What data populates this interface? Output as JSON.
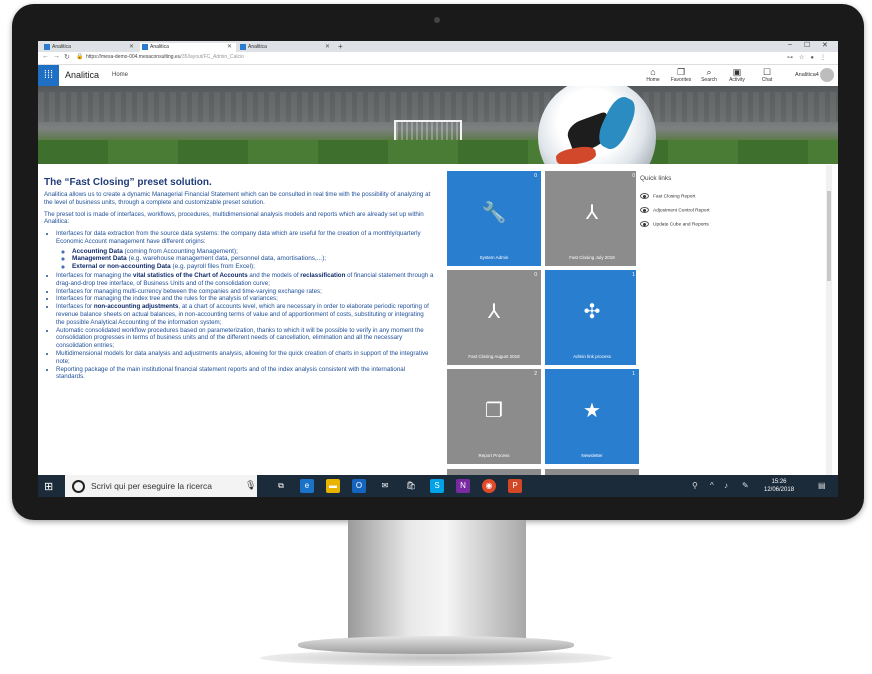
{
  "browser": {
    "tabs": [
      "Analitica",
      "Analitica",
      "Analitica"
    ],
    "new_tab": "+",
    "window_controls": [
      "–",
      "☐",
      "✕"
    ],
    "url_host": "https://mesa-demo-004.mesaconsulting.eu",
    "url_path": "/35/layout/FC_Admin_Calcio"
  },
  "app": {
    "title": "Analitica",
    "breadcrumb": "Home",
    "header_icons": [
      {
        "icon": "home-icon",
        "label": "Home"
      },
      {
        "icon": "favorites-icon",
        "label": "Favorites"
      },
      {
        "icon": "search-icon",
        "label": "Search"
      },
      {
        "icon": "activity-icon",
        "label": "Activity"
      },
      {
        "icon": "chat-icon",
        "label": "Chat"
      }
    ],
    "user": "Analitica4"
  },
  "content": {
    "title": "The “Fast Closing” preset solution.",
    "p1": "Analitica allows us to create a dynamic Managerial Financial Statement which can be consulted in real time with the possibility of analyzing at the level of business units, through a complete and customizable preset solution.",
    "p2": "The preset tool is made of interfaces, workflows, procedures, multidimensional analysis models and reports which are already set up within Analitica:",
    "b1": "Interfaces for data extraction from the source data systems: the company data which are useful for the creation of a monthly/quarterly Economic Account management have different origins:",
    "s1_bold": "Accounting Data",
    "s1_rest": " (coming from Accounting Management);",
    "s2_bold": "Management Data",
    "s2_rest": " (e.g. warehouse management data, personnel data, amortisations,...);",
    "s3_bold": "External or non-accounting Data",
    "s3_rest": " (e.g. payroll files from Excel);",
    "b2_a": "Interfaces for managing the ",
    "b2_bold1": "vital statistics of the Chart of Accounts",
    "b2_b": " and the models of ",
    "b2_bold2": "reclassification",
    "b2_c": " of financial statement through a drag-and-drop tree interface, of Business Units and of the consolidation curve;",
    "b3": "Interfaces for managing multi-currency between the companies and time-varying exchange rates;",
    "b4": "Interfaces for managing the index tree and the rules for the analysis of variances;",
    "b5_a": "Interfaces for ",
    "b5_bold": "non-accounting adjustments",
    "b5_b": ", at a chart of accounts level, which are necessary in order to elaborate periodic reporting of revenue balance sheets on actual balances, in non-accounting terms of value and of apportionment of costs, substituting or integrating the possible Analytical Accounting of the information system;",
    "b6": "Automatic consolidated workflow procedures based on parameterization, thanks to which it will be possible to verify in any moment the consolidation progresses in terms of business units and of the different needs of cancellation, elimination and all the necessary consolidation entries;",
    "b7": "Multidimensional models for data analysis and adjustments analysis, allowing for the quick creation of charts in support of the integrative note;",
    "b8": "Reporting package of the main institutional financial statement reports and of the index analysis consistent with the international standards."
  },
  "tiles": [
    {
      "label": "System Admin",
      "count": "0",
      "color": "blue",
      "icon": "wrench-icon",
      "glyph": "🔧"
    },
    {
      "label": "Fast Closing July 2018",
      "count": "0",
      "color": "gray",
      "icon": "process-icon",
      "glyph": "⅄"
    },
    {
      "label": "Fast Closing August 2018",
      "count": "0",
      "color": "gray",
      "icon": "process-icon",
      "glyph": "⅄"
    },
    {
      "label": "Admin link process",
      "count": "1",
      "color": "blue",
      "icon": "pinwheel-icon",
      "glyph": "✣"
    },
    {
      "label": "Report Process",
      "count": "2",
      "color": "gray",
      "icon": "report-icon",
      "glyph": "❐"
    },
    {
      "label": "Newsletter",
      "count": "1",
      "color": "blue",
      "icon": "star-icon",
      "glyph": "★"
    }
  ],
  "quick_links": {
    "title": "Quick links",
    "items": [
      "Fast Closing Report",
      "Adjustment Control Report",
      "Update Cube and Reports"
    ]
  },
  "taskbar": {
    "search_placeholder": "Scrivi qui per eseguire la ricerca",
    "time": "15:26",
    "date": "12/06/2018"
  }
}
